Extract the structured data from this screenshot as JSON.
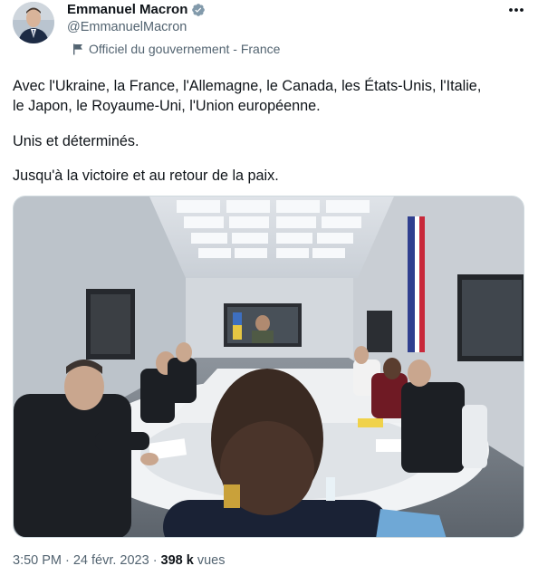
{
  "author": {
    "display_name": "Emmanuel Macron",
    "handle": "@EmmanuelMacron",
    "affiliation": "Officiel du gouvernement - France",
    "verified_icon": "verified-badge-icon",
    "avatar_icon": "avatar-photo"
  },
  "tweet": {
    "line1": "Avec l'Ukraine, la France, l'Allemagne, le Canada, les États-Unis, l'Italie,",
    "line2": "le Japon, le Royaume-Uni, l'Union européenne.",
    "line3": "Unis et déterminés.",
    "line4": "Jusqu'à la victoire et au retour de la paix."
  },
  "meta": {
    "time": "3:50 PM",
    "separator": "·",
    "date": "24 févr. 2023",
    "views_count": "398 k",
    "views_label": "vues"
  },
  "colors": {
    "text": "#0f1419",
    "secondary": "#536471",
    "verified": "#829aab"
  }
}
